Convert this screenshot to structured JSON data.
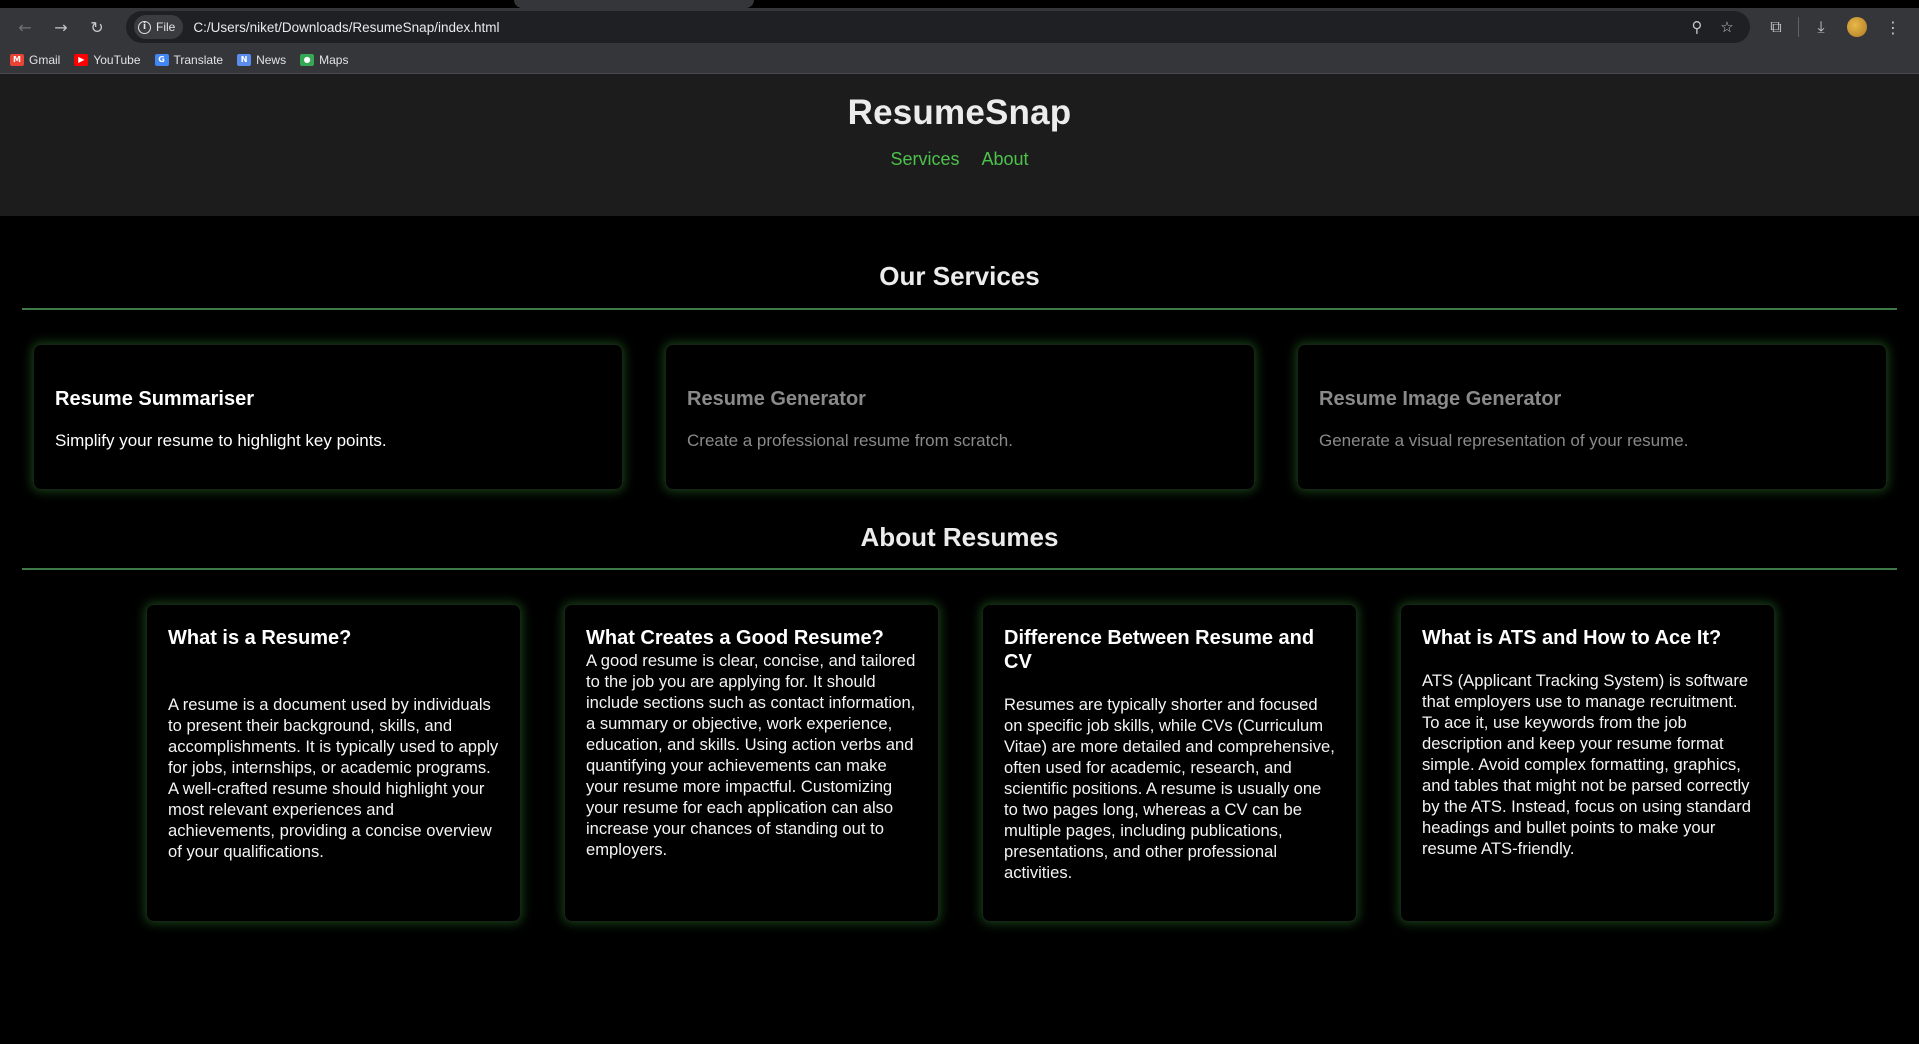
{
  "browser": {
    "url_scheme_label": "File",
    "url": "C:/Users/niket/Downloads/ResumeSnap/index.html",
    "bookmarks": [
      {
        "label": "Gmail",
        "icon": "gmail-icon",
        "color": "#ea4335"
      },
      {
        "label": "YouTube",
        "icon": "youtube-icon",
        "color": "#ff0000"
      },
      {
        "label": "Translate",
        "icon": "translate-icon",
        "color": "#4285f4"
      },
      {
        "label": "News",
        "icon": "news-icon",
        "color": "#5b8def"
      },
      {
        "label": "Maps",
        "icon": "maps-icon",
        "color": "#34a853"
      }
    ]
  },
  "header": {
    "title": "ResumeSnap",
    "nav": [
      {
        "label": "Services"
      },
      {
        "label": "About"
      }
    ],
    "accent_color": "#4cc24c"
  },
  "services": {
    "title": "Our Services",
    "cards": [
      {
        "title": "Resume Summariser",
        "description": "Simplify your resume to highlight key points."
      },
      {
        "title": "Resume Generator",
        "description": "Create a professional resume from scratch."
      },
      {
        "title": "Resume Image Generator",
        "description": "Generate a visual representation of your resume."
      }
    ]
  },
  "about": {
    "title": "About Resumes",
    "cards": [
      {
        "title": "What is a Resume?",
        "body": "A resume is a document used by individuals to present their background, skills, and accomplishments. It is typically used to apply for jobs, internships, or academic programs. A well-crafted resume should highlight your most relevant experiences and achievements, providing a concise overview of your qualifications."
      },
      {
        "title": "What Creates a Good Resume?",
        "body": "A good resume is clear, concise, and tailored to the job you are applying for. It should include sections such as contact information, a summary or objective, work experience, education, and skills. Using action verbs and quantifying your achievements can make your resume more impactful. Customizing your resume for each application can also increase your chances of standing out to employers."
      },
      {
        "title": "Difference Between Resume and CV",
        "body": "Resumes are typically shorter and focused on specific job skills, while CVs (Curriculum Vitae) are more detailed and comprehensive, often used for academic, research, and scientific positions. A resume is usually one to two pages long, whereas a CV can be multiple pages, including publications, presentations, and other professional activities."
      },
      {
        "title": "What is ATS and How to Ace It?",
        "body": "ATS (Applicant Tracking System) is software that employers use to manage recruitment. To ace it, use keywords from the job description and keep your resume format simple. Avoid complex formatting, graphics, and tables that might not be parsed correctly by the ATS. Instead, focus on using standard headings and bullet points to make your resume ATS-friendly."
      }
    ]
  }
}
